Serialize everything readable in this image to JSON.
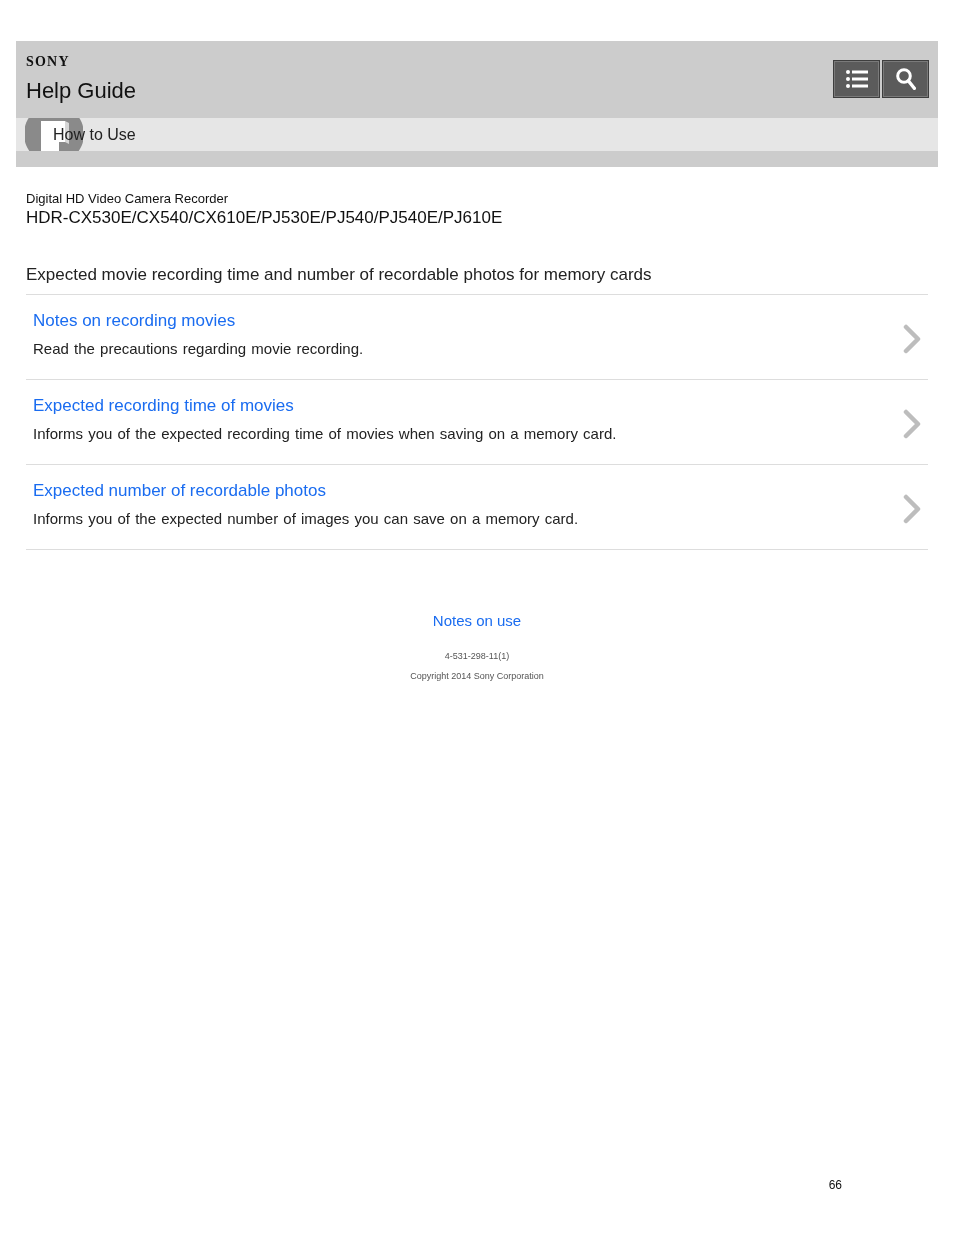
{
  "header": {
    "logo": "SONY",
    "title": "Help Guide",
    "buttons": [
      {
        "kind": "contents"
      },
      {
        "kind": "search"
      }
    ]
  },
  "breadcrumb": {
    "label": "How to Use"
  },
  "product": {
    "category": "Digital HD Video Camera Recorder",
    "models": "HDR-CX530E/CX540/CX610E/PJ530E/PJ540/PJ540E/PJ610E"
  },
  "page_title": "Expected movie recording time and number of recordable photos for memory cards",
  "topics": [
    {
      "title": "Notes on recording movies",
      "description": "Read the precautions regarding movie recording."
    },
    {
      "title": "Expected recording time of movies",
      "description": "Informs you of the expected recording time of movies when saving on a memory card."
    },
    {
      "title": "Expected number of recordable photos",
      "description": "Informs you of the expected number of images you can save on a memory card."
    }
  ],
  "footer": {
    "link": "Notes on use",
    "doc_number": "4-531-298-11(1)",
    "copyright": "Copyright 2014 Sony Corporation"
  },
  "page_number": "66"
}
